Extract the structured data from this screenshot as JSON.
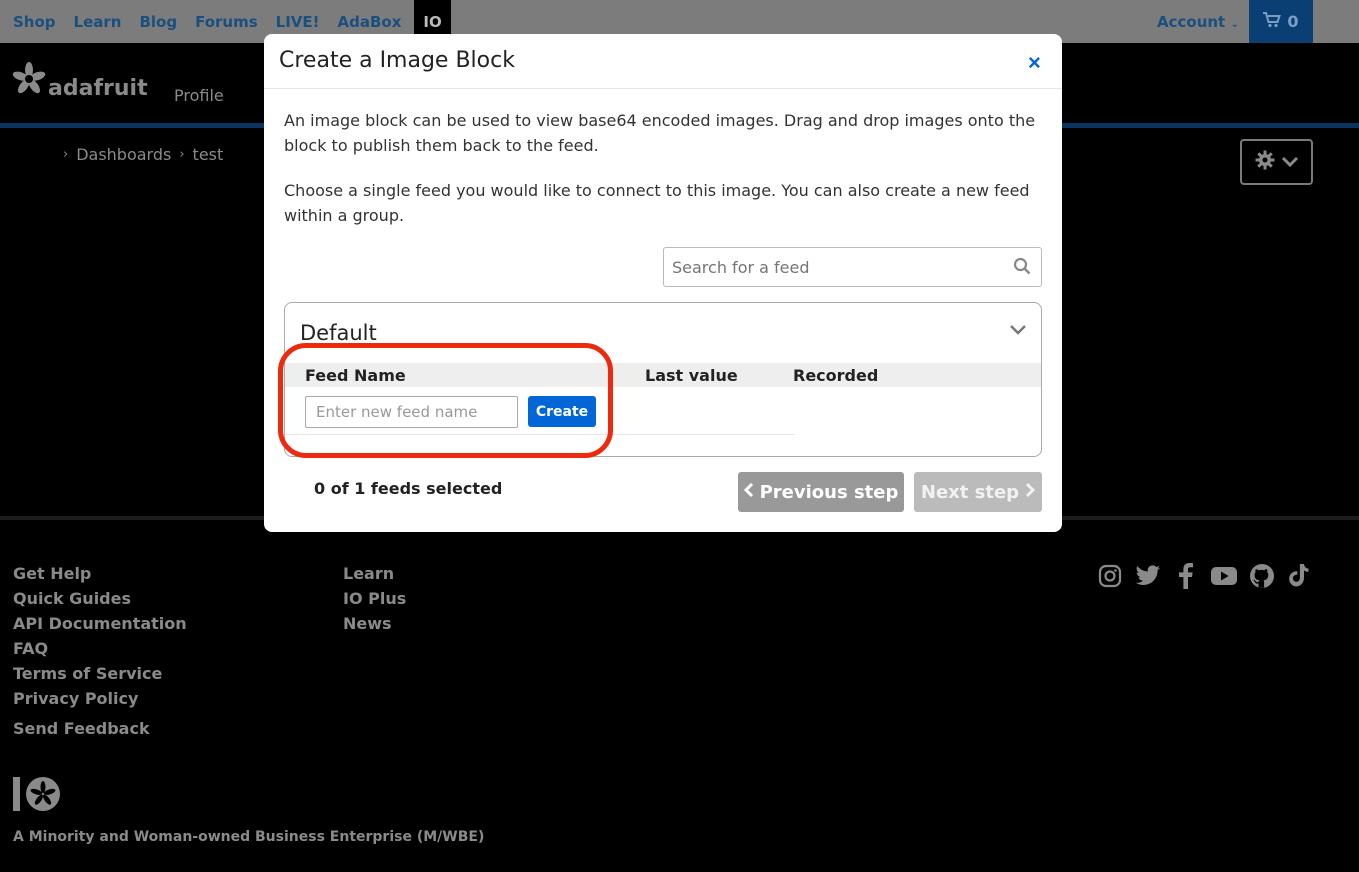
{
  "topnav": {
    "links": [
      "Shop",
      "Learn",
      "Blog",
      "Forums",
      "LIVE!",
      "AdaBox"
    ],
    "io_tab": "IO",
    "account": "Account",
    "cart_count": "0"
  },
  "header": {
    "logo_text": "adafruit",
    "profile": "Profile"
  },
  "breadcrumb": {
    "dashboards": "Dashboards",
    "current": "test"
  },
  "modal": {
    "title": "Create a Image Block",
    "close": "×",
    "description": "An image block can be used to view base64 encoded images. Drag and drop images onto the block to publish them back to the feed.",
    "instruction": "Choose a single feed you would like to connect to this image. You can also create a new feed within a group.",
    "search_placeholder": "Search for a feed",
    "group": {
      "name": "Default",
      "columns": [
        "Feed Name",
        "Last value",
        "Recorded"
      ],
      "new_feed_placeholder": "Enter new feed name",
      "create_label": "Create"
    },
    "selected_status": "0 of 1 feeds selected",
    "prev_label": "Previous step",
    "next_label": "Next step"
  },
  "footer": {
    "col1": [
      "Get Help",
      "Quick Guides",
      "API Documentation",
      "FAQ",
      "Terms of Service",
      "Privacy Policy"
    ],
    "col2": [
      "Learn",
      "IO Plus",
      "News"
    ],
    "feedback": "Send Feedback",
    "social_icons": [
      "instagram-icon",
      "twitter-icon",
      "facebook-icon",
      "youtube-icon",
      "github-icon",
      "tiktok-icon"
    ],
    "mwbe": "A Minority and Woman-owned Business Enterprise (M/WBE)"
  },
  "colors": {
    "accent": "#0366d6",
    "highlight": "#ee2a0e",
    "nav_link": "#1a4f7e"
  }
}
